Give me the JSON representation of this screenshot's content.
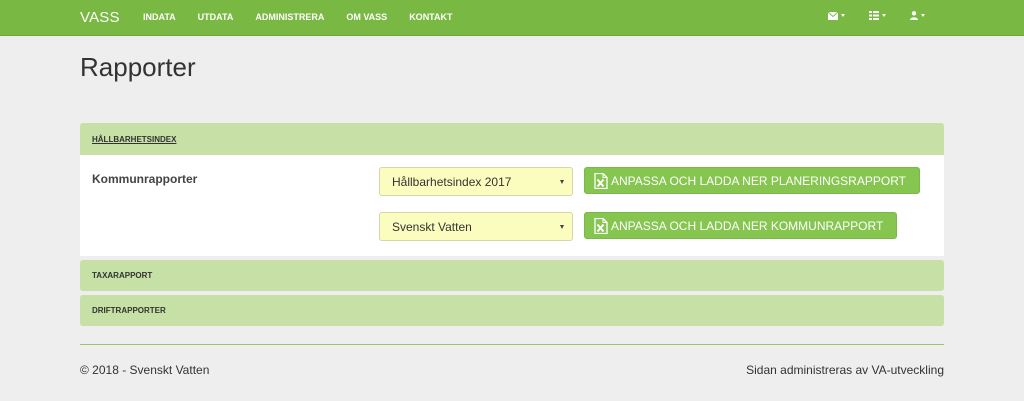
{
  "navbar": {
    "brand": "VASS",
    "links": [
      "INDATA",
      "UTDATA",
      "ADMINISTRERA",
      "OM VASS",
      "KONTAKT"
    ],
    "icons": [
      "envelope-icon",
      "list-icon",
      "user-icon"
    ]
  },
  "page": {
    "title": "Rapporter"
  },
  "panels": {
    "hallbarhetsindex": {
      "title": "HÅLLBARHETSINDEX",
      "row_label": "Kommunrapporter",
      "select1_value": "Hållbarhetsindex 2017",
      "select2_value": "Svenskt Vatten",
      "button1_label": "ANPASSA OCH LADDA NER PLANERINGSRAPPORT",
      "button2_label": "ANPASSA OCH LADDA NER KOMMUNRAPPORT"
    },
    "taxarapport": {
      "title": "TAXARAPPORT"
    },
    "driftrapporter": {
      "title": "DRIFTRAPPORTER"
    }
  },
  "footer": {
    "copyright": "© 2018 - ",
    "org_link": "Svenskt Vatten",
    "admin_text": "Sidan administreras av ",
    "admin_link": "VA-utveckling"
  },
  "colors": {
    "navbar": "#78b843",
    "panel_heading": "#c6e0a6",
    "button": "#86c550",
    "select_bg": "#fbfdbe"
  }
}
